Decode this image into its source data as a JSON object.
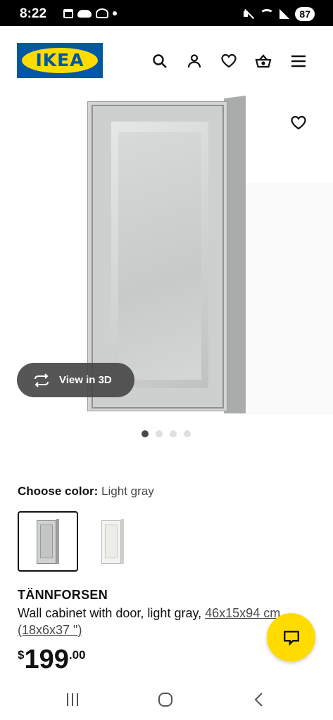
{
  "status_bar": {
    "time": "8:22",
    "battery": "87"
  },
  "header": {
    "logo_text": "IKEA",
    "brand_colors": {
      "blue": "#0058a3",
      "yellow": "#ffdb00"
    },
    "icons": [
      "search-icon",
      "account-icon",
      "heart-icon",
      "basket-icon",
      "menu-icon"
    ]
  },
  "gallery": {
    "view_3d_label": "View in 3D",
    "dots_total": 4,
    "active_dot": 0
  },
  "color_chooser": {
    "label": "Choose color:",
    "selected_value": "Light gray",
    "options": [
      "Light gray",
      "White"
    ]
  },
  "product": {
    "name": "TÄNNFORSEN",
    "description": "Wall cabinet with door, light gray,",
    "dimensions": "46x15x94 cm (18x6x37 \")",
    "price": {
      "currency": "$",
      "integer": "199",
      "decimal": ".00"
    }
  }
}
